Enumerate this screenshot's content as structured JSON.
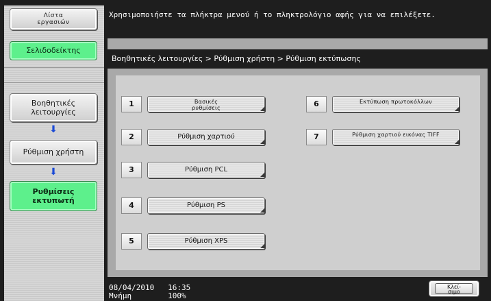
{
  "header": {
    "job_list_label": "Λίστα\nεργασιών",
    "message": "Χρησιμοποιήστε τα πλήκτρα μενού ή το πληκτρολόγιο αφής για να επιλέξετε."
  },
  "sidebar": {
    "bookmark_label": "Σελιδοδείκτης",
    "nav": [
      {
        "label": "Βοηθητικές λειτουργίες"
      },
      {
        "label": "Ρύθμιση χρήστη"
      },
      {
        "label": "Ρυθμίσεις εκτυπωτή"
      }
    ]
  },
  "breadcrumb": "Βοηθητικές λειτουργίες > Ρύθμιση χρήστη > Ρύθμιση εκτύπωσης",
  "menu": [
    {
      "num": "1",
      "label": "Βασικές\nρυθμίσεις"
    },
    {
      "num": "2",
      "label": "Ρύθμιση χαρτιού"
    },
    {
      "num": "3",
      "label": "Ρύθμιση PCL"
    },
    {
      "num": "4",
      "label": "Ρύθμιση PS"
    },
    {
      "num": "5",
      "label": "Ρύθμιση XPS"
    },
    {
      "num": "6",
      "label": "Εκτύπωση\nπρωτοκόλλων"
    },
    {
      "num": "7",
      "label": "Ρύθμιση χαρτιού\nεικόνας TIFF"
    }
  ],
  "footer": {
    "date": "08/04/2010",
    "time": "16:35",
    "memory_label": "Μνήμη",
    "memory_value": "100%",
    "close_label": "Κλεί-\nσιμο"
  },
  "colors": {
    "accent_green": "#5df08c",
    "arrow_blue": "#1c4bd6",
    "background": "#1e1e1e"
  }
}
